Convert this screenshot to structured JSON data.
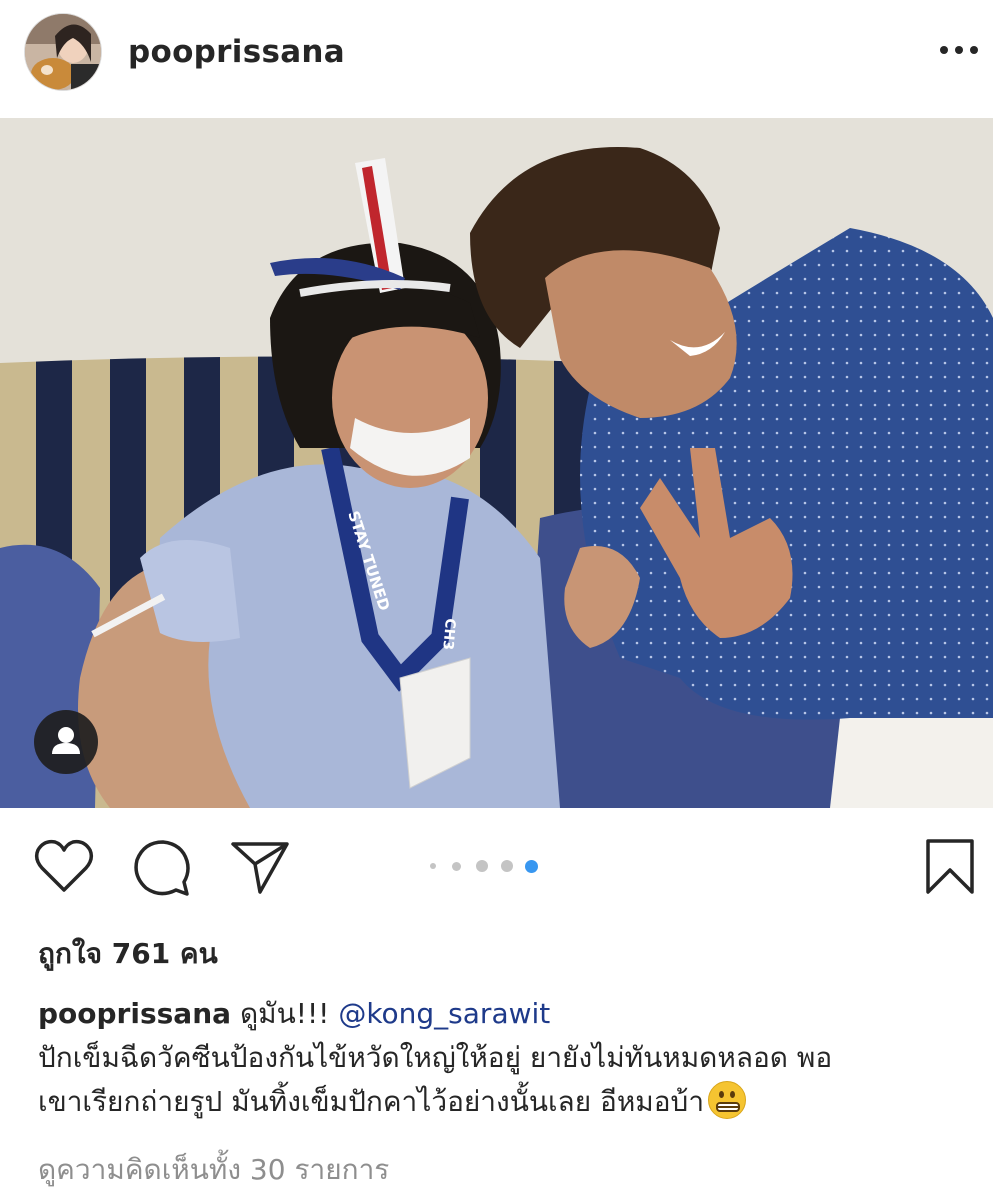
{
  "post": {
    "username": "pooprissana",
    "likes_text": "ถูกใจ 761 คน",
    "caption": {
      "username": "pooprissana",
      "lead": "ดูมัน!!!",
      "mention": "@kong_sarawit",
      "line1": "ปักเข็มฉีดวัคซีนป้องกันไข้หวัดใหญ่ให้อยู่ ยายังไม่ทันหมดหลอด พอ",
      "line2": "เขาเรียกถ่ายรูป มันทิ้งเข็มปักคาไว้อย่างนั้นเลย อีหมอบ้า"
    },
    "view_comments": "ดูความคิดเห็นทั้ง 30 รายการ",
    "carousel": {
      "count": 5,
      "active_index": 4
    },
    "photo_text": {
      "lanyard_1": "STAY TUNED",
      "lanyard_2": "CH3"
    }
  },
  "icons": {
    "more": "more-horizontal-icon",
    "like": "heart-icon",
    "comment": "comment-bubble-icon",
    "share": "paper-plane-icon",
    "save": "bookmark-icon",
    "tag": "user-tag-icon",
    "emoji": "grimacing-face-emoji"
  },
  "colors": {
    "text": "#262626",
    "muted": "#8e8e8e",
    "mention": "#1e3a8a",
    "active_dot": "#3897f0"
  }
}
